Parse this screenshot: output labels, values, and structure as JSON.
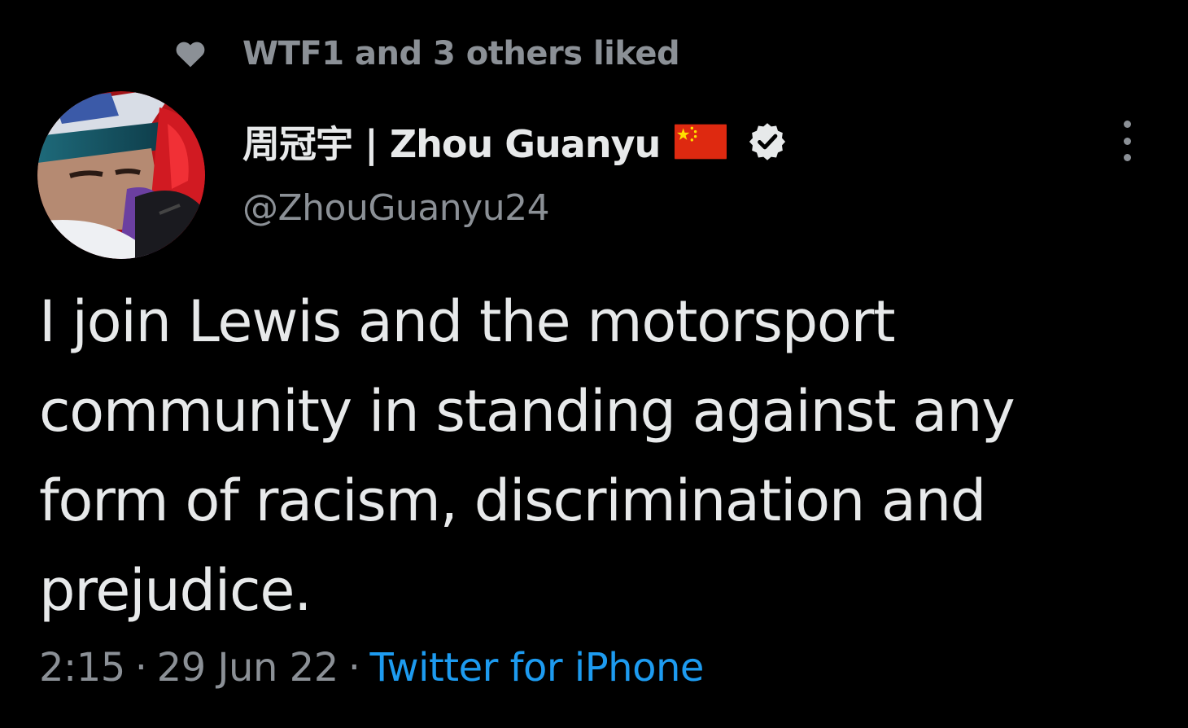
{
  "social_context": {
    "icon": "heart-icon",
    "text": "WTF1 and 3 others liked"
  },
  "author": {
    "avatar": "avatar-racing-helmet",
    "display_name": "周冠宇 | Zhou Guanyu",
    "flag_icon": "china-flag-icon",
    "verified_icon": "verified-badge-icon",
    "handle": "@ZhouGuanyu24"
  },
  "more_icon": "more-options-icon",
  "tweet": {
    "text": "I join Lewis and the motorsport community in standing against any form of racism, discrimination and prejudice.",
    "time": "2:15",
    "separator": "·",
    "date": "29 Jun 22",
    "source": "Twitter for iPhone"
  },
  "colors": {
    "background": "#000000",
    "primary_text": "#e7e9ea",
    "secondary_text": "#8b9096",
    "link": "#1d9bf0"
  }
}
